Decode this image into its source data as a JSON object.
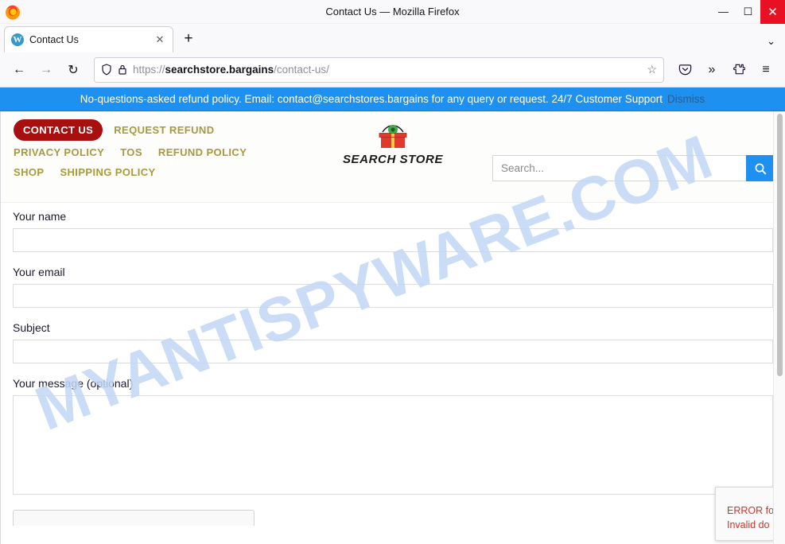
{
  "browser": {
    "window_title": "Contact Us — Mozilla Firefox",
    "minimize_label": "—",
    "maximize_label": "☐",
    "close_label": "✕",
    "tab": {
      "title": "Contact Us",
      "favicon": "wordpress-icon",
      "favicon_glyph": "W",
      "close_label": "✕"
    },
    "new_tab_label": "+",
    "tab_list_chevron": "⌄",
    "nav": {
      "back": "←",
      "forward": "→",
      "reload": "↻",
      "shield_icon": "shield",
      "lock_icon": "lock",
      "url_scheme": "https://",
      "url_domain": "searchstore.bargains",
      "url_path": "/contact-us/",
      "bookmark_star": "☆",
      "pocket": "save-to-pocket",
      "overflow": "»",
      "extensions": "extensions-puzzle",
      "app_menu": "≡"
    }
  },
  "promo_banner": {
    "message": "No-questions-asked refund policy. Email: contact@searchstores.bargains for any query or request. 24/7 Customer Support",
    "dismiss_label": "Dismiss",
    "background_color": "#1e90f0",
    "text_color": "#ffffff"
  },
  "site": {
    "logo_text": "SEARCH STORE",
    "menu": {
      "row1": [
        {
          "label": "CONTACT US",
          "active": true
        },
        {
          "label": "REQUEST REFUND",
          "active": false
        }
      ],
      "row2": [
        {
          "label": "PRIVACY POLICY",
          "active": false
        },
        {
          "label": "TOS",
          "active": false
        },
        {
          "label": "REFUND POLICY",
          "active": false
        }
      ],
      "row3": [
        {
          "label": "SHOP",
          "active": false
        },
        {
          "label": "SHIPPING POLICY",
          "active": false
        }
      ]
    },
    "active_color": "#a81010",
    "menu_color": "#a89a3c",
    "search": {
      "placeholder": "Search...",
      "value": "",
      "button_icon": "search-icon"
    }
  },
  "form": {
    "name_label": "Your name",
    "name_value": "",
    "email_label": "Your email",
    "email_value": "",
    "subject_label": "Subject",
    "subject_value": "",
    "message_label": "Your message (optional)",
    "message_value": ""
  },
  "recaptcha_error": {
    "line1": "ERROR fo",
    "line2": "Invalid do",
    "color": "#d93025"
  },
  "watermark": {
    "text": "MYANTISPYWARE.COM",
    "color": "#c3d8f5"
  }
}
